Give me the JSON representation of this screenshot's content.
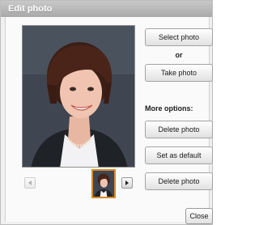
{
  "window": {
    "title": "Edit photo"
  },
  "photo": {
    "description_icon": "portrait-photo"
  },
  "navigation": {
    "prev_icon": "arrow-left-icon",
    "next_icon": "arrow-right-icon"
  },
  "actions": {
    "select_photo": "Select photo",
    "or": "or",
    "take_photo": "Take photo",
    "more_options": "More options:",
    "delete_photo": "Delete photo",
    "set_as_default": "Set as default",
    "delete_photo_2": "Delete photo"
  },
  "footer": {
    "close": "Close"
  }
}
